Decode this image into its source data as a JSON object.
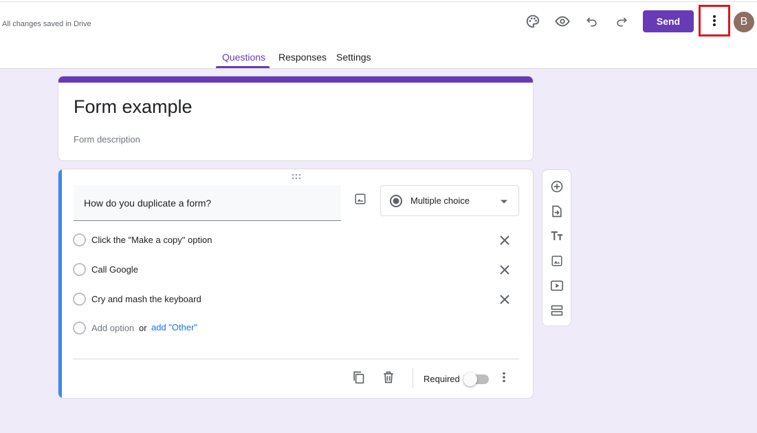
{
  "header": {
    "save_status": "All changes saved in Drive",
    "send_label": "Send",
    "avatar_initial": "B",
    "icons": [
      "palette-icon",
      "preview-eye-icon",
      "undo-icon",
      "redo-icon",
      "more-vert-icon"
    ],
    "highlight_color": "#e0141e"
  },
  "tabs": [
    {
      "label": "Questions",
      "active": true
    },
    {
      "label": "Responses",
      "active": false
    },
    {
      "label": "Settings",
      "active": false
    }
  ],
  "form": {
    "title": "Form example",
    "description_placeholder": "Form description"
  },
  "question": {
    "text": "How do you duplicate a form?",
    "type": "Multiple choice",
    "options": [
      "Click the \"Make a copy\" option",
      "Call Google",
      "Cry and mash the keyboard"
    ],
    "add_option": "Add option",
    "or_text": "or",
    "add_other": "add \"Other\"",
    "required_label": "Required",
    "required": false
  },
  "side_toolbar": [
    "add-question-icon",
    "import-questions-icon",
    "add-title-icon",
    "add-image-icon",
    "add-video-icon",
    "add-section-icon"
  ],
  "colors": {
    "accent": "#673ab7",
    "background": "#f0ebf8",
    "active_question_bar": "#4285f4",
    "link": "#1a73e8"
  }
}
